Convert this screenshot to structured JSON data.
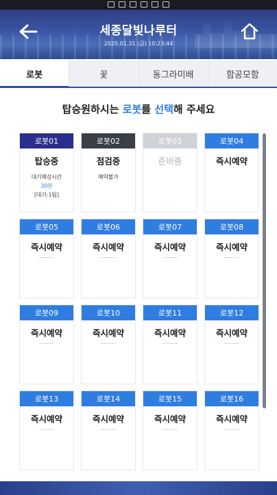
{
  "header": {
    "title": "세종달빛나루터",
    "datetime": "2025.01.31 (금) 10:23:44"
  },
  "tabs": [
    {
      "label": "로봇",
      "active": true
    },
    {
      "label": "꽃",
      "active": false
    },
    {
      "label": "동그라미배",
      "active": false
    },
    {
      "label": "함공모함",
      "active": false
    }
  ],
  "prompt": {
    "part1": "탑승원하시는 ",
    "highlight1": "로봇",
    "part2": "를 ",
    "highlight2": "선택",
    "part3": "해 주세요"
  },
  "robots": [
    {
      "name": "로봇01",
      "status": "탑승중",
      "wait_label": "대기예상시간",
      "wait_time": "30분",
      "queue": "[대기:1팀]",
      "header_color": "#2a2e8c"
    },
    {
      "name": "로봇02",
      "status": "점검중",
      "note": "예약불가",
      "header_color": "#3a3f46"
    },
    {
      "name": "로봇03",
      "status": "준비중",
      "header_color": "#cfd2d6"
    },
    {
      "name": "로봇04",
      "status": "즉시예약",
      "header_color": "#2f7de0"
    },
    {
      "name": "로봇05",
      "status": "즉시예약",
      "header_color": "#2f7de0"
    },
    {
      "name": "로봇06",
      "status": "즉시예약",
      "header_color": "#2f7de0"
    },
    {
      "name": "로봇07",
      "status": "즉시예약",
      "header_color": "#2f7de0"
    },
    {
      "name": "로봇08",
      "status": "즉시예약",
      "header_color": "#2f7de0"
    },
    {
      "name": "로봇09",
      "status": "즉시예약",
      "header_color": "#2f7de0"
    },
    {
      "name": "로봇10",
      "status": "즉시예약",
      "header_color": "#2f7de0"
    },
    {
      "name": "로봇11",
      "status": "즉시예약",
      "header_color": "#2f7de0"
    },
    {
      "name": "로봇12",
      "status": "즉시예약",
      "header_color": "#2f7de0"
    },
    {
      "name": "로봇13",
      "status": "즉시예약",
      "header_color": "#2f7de0"
    },
    {
      "name": "로봇14",
      "status": "즉시예약",
      "header_color": "#2f7de0"
    },
    {
      "name": "로봇15",
      "status": "즉시예약",
      "header_color": "#2f7de0"
    },
    {
      "name": "로봇16",
      "status": "즉시예약",
      "header_color": "#2f7de0"
    }
  ],
  "icons": {
    "back": "arrow-left-icon",
    "home": "home-icon"
  }
}
